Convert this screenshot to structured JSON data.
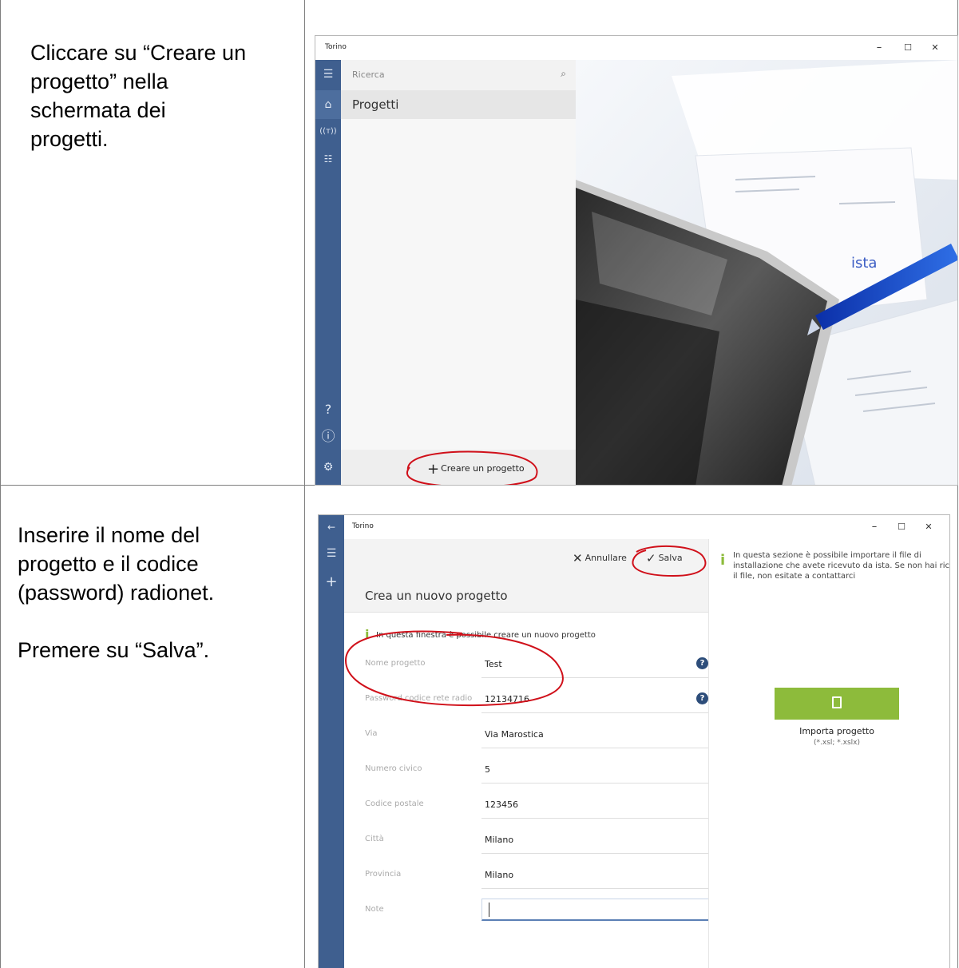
{
  "step1": {
    "instruction": [
      "Cliccare su “Creare un",
      "progetto” nella",
      "schermata dei",
      "progetti."
    ],
    "window": {
      "title": "Torino",
      "controls": {
        "minimize": "–",
        "maximize": "☐",
        "close": "✕"
      },
      "search_placeholder": "Ricerca",
      "nav_label": "Progetti",
      "create_button": "Creare un progetto",
      "rail_icons": [
        "hamburger-icon",
        "home-icon",
        "antenna-icon",
        "list-icon",
        "help-icon",
        "info-icon",
        "settings-icon"
      ],
      "photo_brand": "ista"
    }
  },
  "step2": {
    "instruction_lines": [
      "Inserire il nome del",
      "progetto e il codice",
      "(password) radionet."
    ],
    "instruction_save": "Premere su “Salva”.",
    "window": {
      "title": "Torino",
      "controls": {
        "minimize": "–",
        "maximize": "☐",
        "close": "✕"
      },
      "cancel_label": "Annullare",
      "save_label": "Salva",
      "page_title": "Crea un nuovo progetto",
      "info_text": "In questa finestra è possibile creare un nuovo progetto",
      "fields": [
        {
          "label": "Nome progetto",
          "value": "Test",
          "help": true
        },
        {
          "label": "Password codice rete radio",
          "value": "12134716",
          "help": true
        },
        {
          "label": "Via",
          "value": "Via Marostica"
        },
        {
          "label": "Numero civico",
          "value": "5"
        },
        {
          "label": "Codice postale",
          "value": "123456"
        },
        {
          "label": "Città",
          "value": "Milano"
        },
        {
          "label": "Provincia",
          "value": "Milano"
        }
      ],
      "note_label": "Note",
      "note_value": "",
      "side_info": "In questa sezione è possibile importare il file di installazione che avete ricevuto da ista. Se non hai ricevuto il file, non esitate a contattarci",
      "import_label": "Importa progetto",
      "import_extensions": "(*.xsl; *.xslx)"
    }
  },
  "colors": {
    "rail": "#3f5f8f",
    "accent_green": "#8dbb3b",
    "annotation_red": "#d0101a"
  }
}
